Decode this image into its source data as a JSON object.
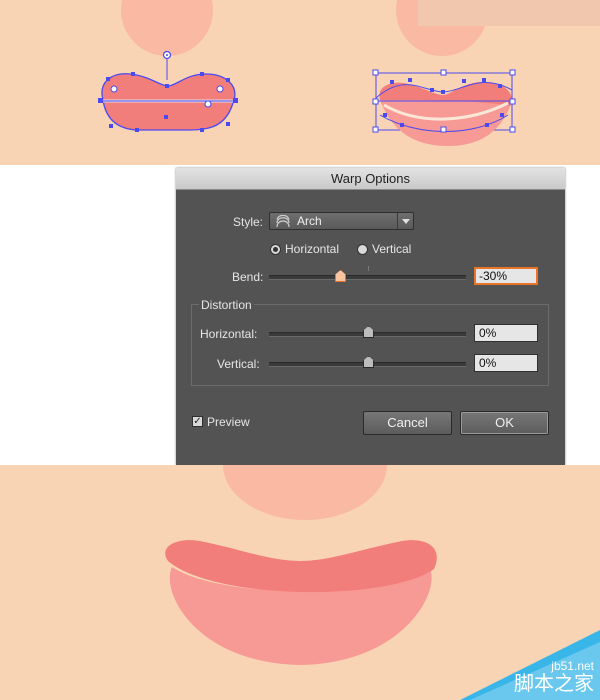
{
  "dialog": {
    "title": "Warp Options",
    "style_label": "Style:",
    "style_value": "Arch",
    "style_icon": "arch-warp-icon",
    "orientation": {
      "horizontal_label": "Horizontal",
      "vertical_label": "Vertical",
      "selected": "Horizontal"
    },
    "bend": {
      "label": "Bend:",
      "value": "-30%",
      "level": -30
    },
    "distortion": {
      "title": "Distortion",
      "horizontal": {
        "label": "Horizontal:",
        "value": "0%",
        "level": 0
      },
      "vertical": {
        "label": "Vertical:",
        "value": "0%",
        "level": 0
      }
    },
    "preview": {
      "label": "Preview",
      "checked": true
    },
    "buttons": {
      "cancel": "Cancel",
      "ok": "OK"
    }
  },
  "watermark": {
    "domain": "jb51.net",
    "name": "脚本之家"
  },
  "colors": {
    "skin": "#f9d4b4",
    "cheek": "#f9b9a2",
    "lip": "#f27e7b",
    "lip_light": "#f79994",
    "selection": "#4a4af0",
    "dialog_bg": "#535353",
    "focus": "#e8732a",
    "watermark_blue": "#38b6e8"
  }
}
